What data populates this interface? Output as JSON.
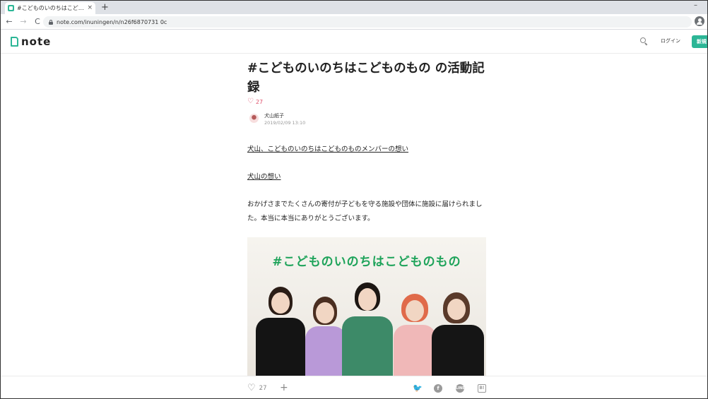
{
  "browser": {
    "tab_title": "#こどものいのちはこどものもの の活動",
    "tab_close": "×",
    "new_tab": "+",
    "window_minimize": "–",
    "url": "note.com/inuningen/n/n26f6870731 0c",
    "nav_back": "←",
    "nav_forward": "→",
    "nav_reload": "C"
  },
  "header": {
    "logo_text": "note",
    "login_label": "ログイン",
    "register_label": "新規"
  },
  "article": {
    "title": "#こどものいのちはこどものもの の活動記録",
    "like_count": "27",
    "author_name": "犬山紙子",
    "post_date": "2019/02/09 13:10",
    "link_1": "犬山、こどものいのちはこどものものメンバーの想い",
    "link_2": "犬山の想い",
    "paragraph": "おかげさまでたくさんの寄付が子どもを守る施設や団体に施設に届けられました。本当に本当にありがとうございます。",
    "image_caption": "#こどものいのちはこどものもの"
  },
  "action_bar": {
    "like_count": "27",
    "add_label": "+",
    "twitter_glyph": "🐦",
    "facebook_glyph": "f",
    "line_glyph": "LINE",
    "hatena_glyph": "B!"
  },
  "icons": [
    "favicon-icon",
    "lock-icon",
    "profile-icon",
    "logo-mark-icon",
    "search-icon",
    "heart-icon",
    "plus-icon",
    "twitter-icon",
    "facebook-icon",
    "line-icon",
    "hatena-icon"
  ],
  "colors": {
    "brand": "#2cb696",
    "like": "#e0526d",
    "caption": "#1ea35a"
  }
}
